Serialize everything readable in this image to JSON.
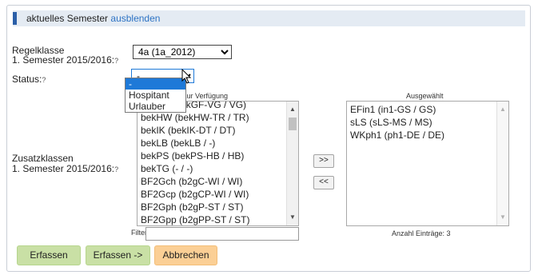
{
  "header": {
    "title": "aktuelles Semester",
    "toggle_link": "ausblenden"
  },
  "regelklasse": {
    "label": "Regelklasse",
    "semester_label": "1. Semester 2015/2016:",
    "help": "?",
    "selected": "4a (1a_2012)"
  },
  "status": {
    "label": "Status:",
    "help": "?",
    "selected": "-",
    "options": [
      "-",
      "Hospitant",
      "Urlauber"
    ],
    "highlighted_index": 0
  },
  "zusatzklassen": {
    "label": "Zusatzklassen",
    "semester_label": "1. Semester 2015/2016:",
    "help": "?",
    "available_title": "Zur Verfügung",
    "available_items": [
      "bekGF (bekGF-VG / VG)",
      "bekHW (bekHW-TR / TR)",
      "bekIK (bekIK-DT / DT)",
      "bekLB (bekLB / -)",
      "bekPS (bekPS-HB / HB)",
      "bekTG (- / -)",
      "BF2Gch (b2gC-WI / WI)",
      "BF2Gcp (b2gCP-WI / WI)",
      "BF2Gph (b2gP-ST / ST)",
      "BF2Gpp (b2gPP-ST / ST)"
    ],
    "selected_title": "Ausgewählt",
    "selected_items": [
      "EFin1 (in1-GS / GS)",
      "sLS (sLS-MS / MS)",
      "WKph1 (ph1-DE / DE)"
    ],
    "filter_label": "Filter:",
    "filter_value": "",
    "count_text": "Anzahl Einträge: 3",
    "add_button": ">>",
    "remove_button": "<<"
  },
  "buttons": {
    "submit": "Erfassen",
    "submit_next": "Erfassen ->",
    "cancel": "Abbrechen"
  },
  "colors": {
    "accent": "#2b5fa8",
    "link": "#2d73c4",
    "highlight": "#1e79d8",
    "green": "#c9e0a5",
    "orange": "#fbcf95"
  }
}
